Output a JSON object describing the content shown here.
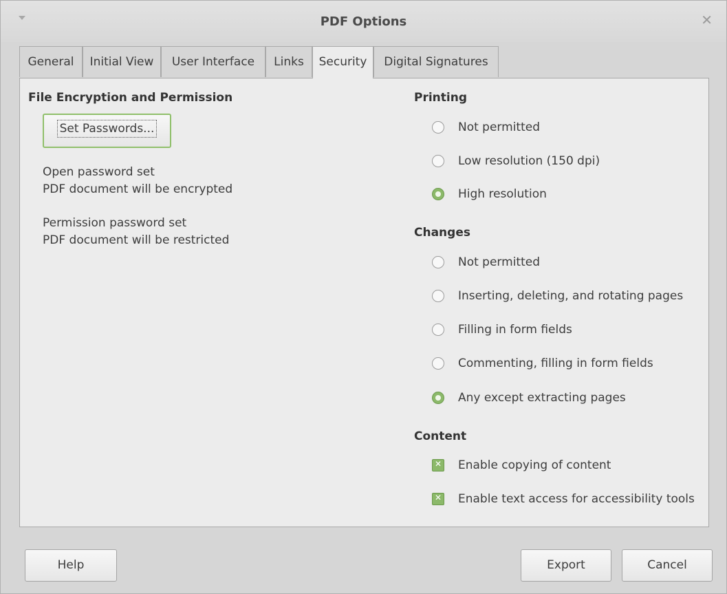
{
  "window": {
    "title": "PDF Options"
  },
  "tabs": [
    "General",
    "Initial View",
    "User Interface",
    "Links",
    "Security",
    "Digital Signatures"
  ],
  "active_tab": "Security",
  "encryption": {
    "heading": "File Encryption and Permission",
    "set_passwords_label": "Set Passwords...",
    "open_status_line1": "Open password set",
    "open_status_line2": "PDF document will be encrypted",
    "perm_status_line1": "Permission password set",
    "perm_status_line2": "PDF document will be restricted"
  },
  "printing": {
    "heading": "Printing",
    "options": [
      {
        "label": "Not permitted",
        "checked": false
      },
      {
        "label": "Low resolution (150 dpi)",
        "checked": false
      },
      {
        "label": "High resolution",
        "checked": true
      }
    ]
  },
  "changes": {
    "heading": "Changes",
    "options": [
      {
        "label": "Not permitted",
        "checked": false
      },
      {
        "label": "Inserting, deleting, and rotating pages",
        "checked": false
      },
      {
        "label": "Filling in form fields",
        "checked": false
      },
      {
        "label": "Commenting, filling in form fields",
        "checked": false
      },
      {
        "label": "Any except extracting pages",
        "checked": true
      }
    ]
  },
  "content": {
    "heading": "Content",
    "options": [
      {
        "label": "Enable copying of content",
        "checked": true
      },
      {
        "label": "Enable text access for accessibility tools",
        "checked": true
      }
    ]
  },
  "buttons": {
    "help": "Help",
    "export": "Export",
    "cancel": "Cancel"
  },
  "colors": {
    "accent": "#8cb96a",
    "background": "#d6d6d6",
    "panel": "#ececec"
  }
}
